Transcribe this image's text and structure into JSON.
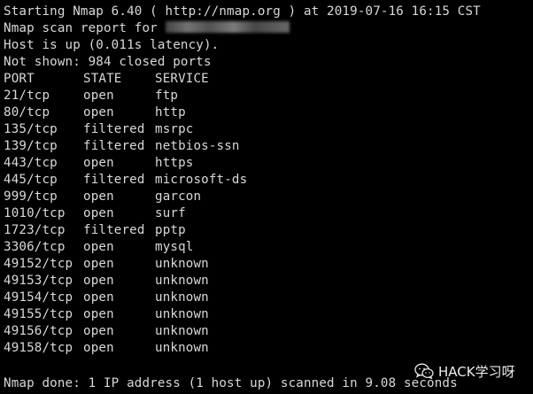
{
  "terminal": {
    "lines": {
      "starting": "Starting Nmap 6.40 ( http://nmap.org ) at 2019-07-16 16:15 CST",
      "scan_report_prefix": "Nmap scan report for ",
      "host_up": "Host is up (0.011s latency).",
      "not_shown": "Not shown: 984 closed ports"
    },
    "table": {
      "headers": {
        "port": "PORT",
        "state": "STATE",
        "service": "SERVICE"
      },
      "rows": [
        {
          "port": "21/tcp",
          "state": "open",
          "service": "ftp"
        },
        {
          "port": "80/tcp",
          "state": "open",
          "service": "http"
        },
        {
          "port": "135/tcp",
          "state": "filtered",
          "service": "msrpc"
        },
        {
          "port": "139/tcp",
          "state": "filtered",
          "service": "netbios-ssn"
        },
        {
          "port": "443/tcp",
          "state": "open",
          "service": "https"
        },
        {
          "port": "445/tcp",
          "state": "filtered",
          "service": "microsoft-ds"
        },
        {
          "port": "999/tcp",
          "state": "open",
          "service": "garcon"
        },
        {
          "port": "1010/tcp",
          "state": "open",
          "service": "surf"
        },
        {
          "port": "1723/tcp",
          "state": "filtered",
          "service": "pptp"
        },
        {
          "port": "3306/tcp",
          "state": "open",
          "service": "mysql"
        },
        {
          "port": "49152/tcp",
          "state": "open",
          "service": "unknown"
        },
        {
          "port": "49153/tcp",
          "state": "open",
          "service": "unknown"
        },
        {
          "port": "49154/tcp",
          "state": "open",
          "service": "unknown"
        },
        {
          "port": "49155/tcp",
          "state": "open",
          "service": "unknown"
        },
        {
          "port": "49156/tcp",
          "state": "open",
          "service": "unknown"
        },
        {
          "port": "49158/tcp",
          "state": "open",
          "service": "unknown"
        }
      ]
    },
    "done": "Nmap done: 1 IP address (1 host up) scanned in 9.08 seconds"
  },
  "watermark": {
    "text": "HACK学习呀",
    "icon": "wechat-icon"
  },
  "colors": {
    "background": "#000000",
    "text": "#d9d9d9"
  }
}
